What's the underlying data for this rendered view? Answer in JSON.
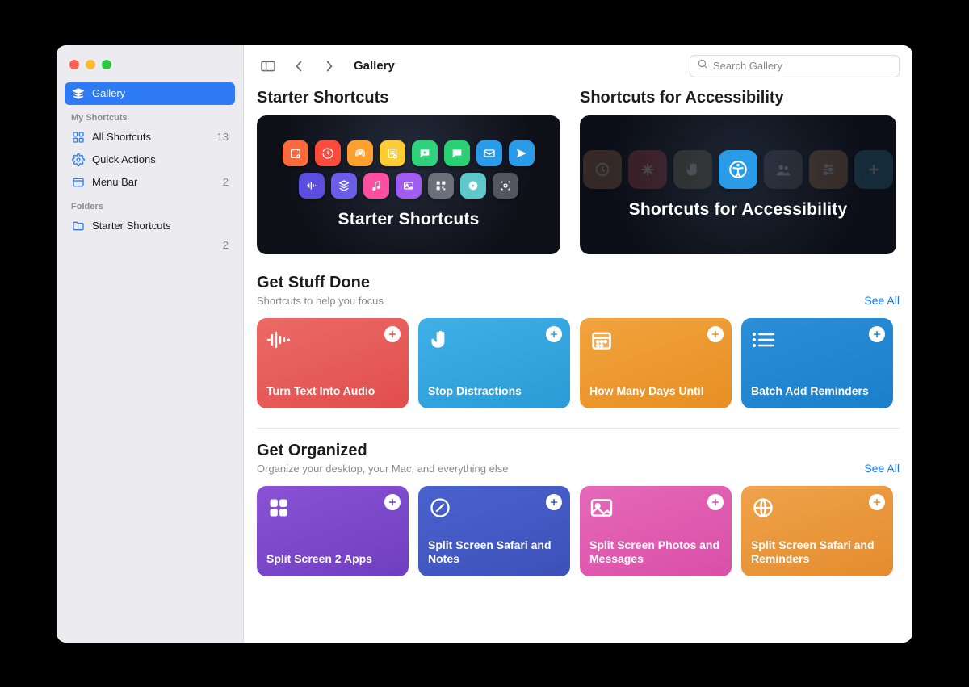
{
  "toolbar": {
    "title": "Gallery",
    "search_placeholder": "Search Gallery"
  },
  "sidebar": {
    "gallery_label": "Gallery",
    "section_my": "My Shortcuts",
    "section_folders": "Folders",
    "items": {
      "all": {
        "label": "All Shortcuts",
        "count": "13"
      },
      "quick": {
        "label": "Quick Actions"
      },
      "menu": {
        "label": "Menu Bar",
        "count": "2"
      },
      "folder_starter": {
        "label": "Starter Shortcuts",
        "count": "2"
      }
    }
  },
  "hero": {
    "starter": {
      "title": "Starter Shortcuts",
      "card_label": "Starter Shortcuts"
    },
    "access": {
      "title": "Shortcuts for Accessibility",
      "card_label": "Shortcuts for Accessibility"
    },
    "peek": {
      "title_first_letter": "G"
    }
  },
  "sections": {
    "done": {
      "title": "Get Stuff Done",
      "sub": "Shortcuts to help you focus",
      "see_all": "See All",
      "cards": [
        {
          "title": "Turn Text Into Audio",
          "color": "g-red"
        },
        {
          "title": "Stop Distractions",
          "color": "g-sky"
        },
        {
          "title": "How Many Days Until",
          "color": "g-orange"
        },
        {
          "title": "Batch Add Reminders",
          "color": "g-blue"
        }
      ]
    },
    "org": {
      "title": "Get Organized",
      "sub": "Organize your desktop, your Mac, and everything else",
      "see_all": "See All",
      "cards": [
        {
          "title": "Split Screen 2 Apps",
          "color": "g-purple"
        },
        {
          "title": "Split Screen Safari and Notes",
          "color": "g-indigo"
        },
        {
          "title": "Split Screen Photos and Messages",
          "color": "g-pink"
        },
        {
          "title": "Split Screen Safari and Reminders",
          "color": "g-amber"
        }
      ]
    }
  },
  "colors": {
    "accent": "#0a7aff"
  }
}
